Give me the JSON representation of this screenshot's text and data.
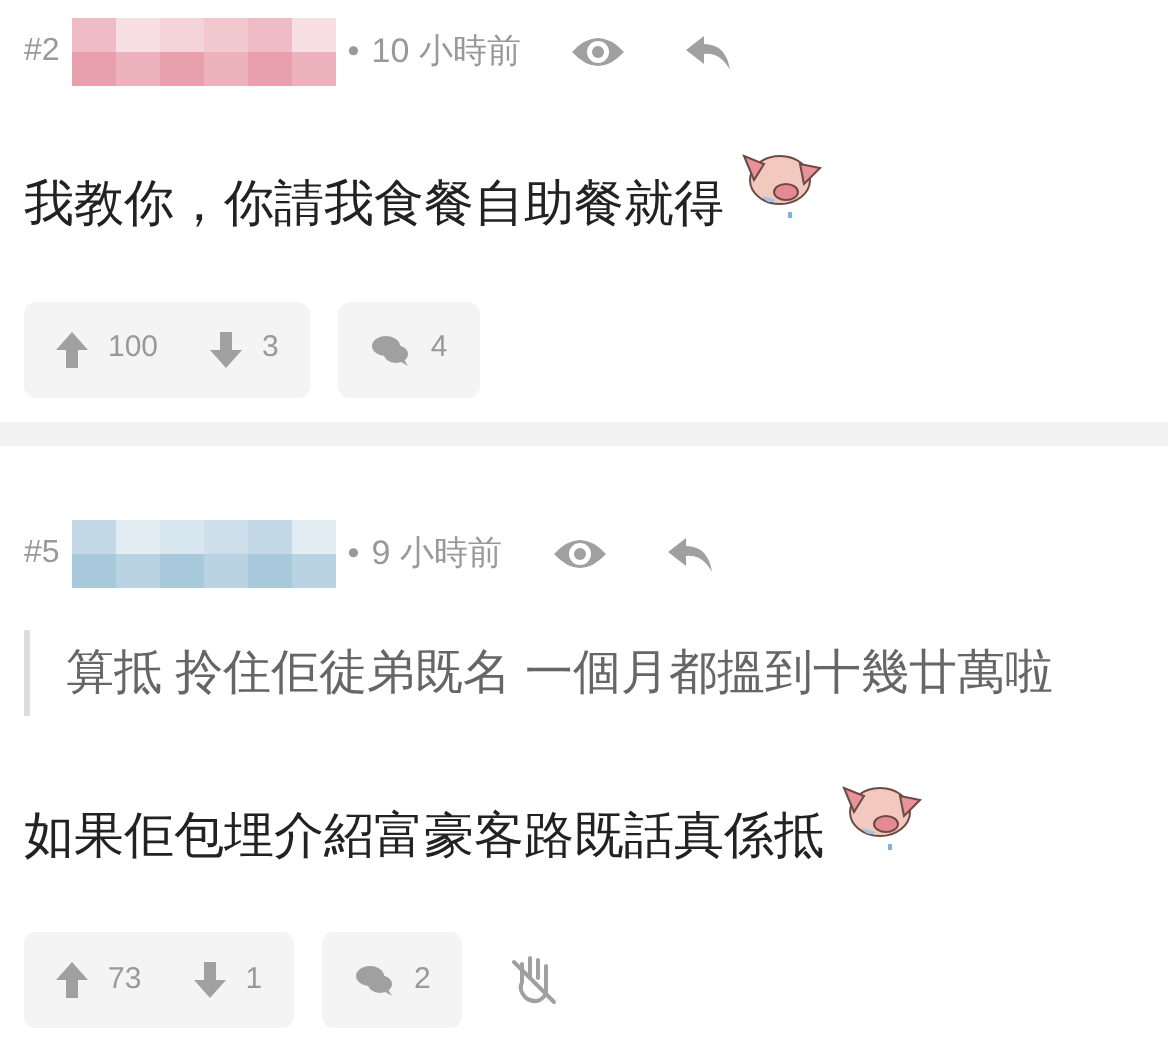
{
  "posts": [
    {
      "number": "#2",
      "color": "#e8a0ac",
      "separator": "•",
      "time": "10 小時前",
      "body": "我教你，你請我食餐自助餐就得",
      "upvotes": "100",
      "downvotes": "3",
      "comments": "4",
      "block_button": false
    },
    {
      "number": "#5",
      "color": "#a8c8dc",
      "separator": "•",
      "time": "9 小時前",
      "quote": "算抵 拎住佢徒弟既名 一個月都搵到十幾廿萬啦",
      "body": "如果佢包埋介紹富豪客路既話真係抵",
      "upvotes": "73",
      "downvotes": "1",
      "comments": "2",
      "block_button": true
    }
  ]
}
